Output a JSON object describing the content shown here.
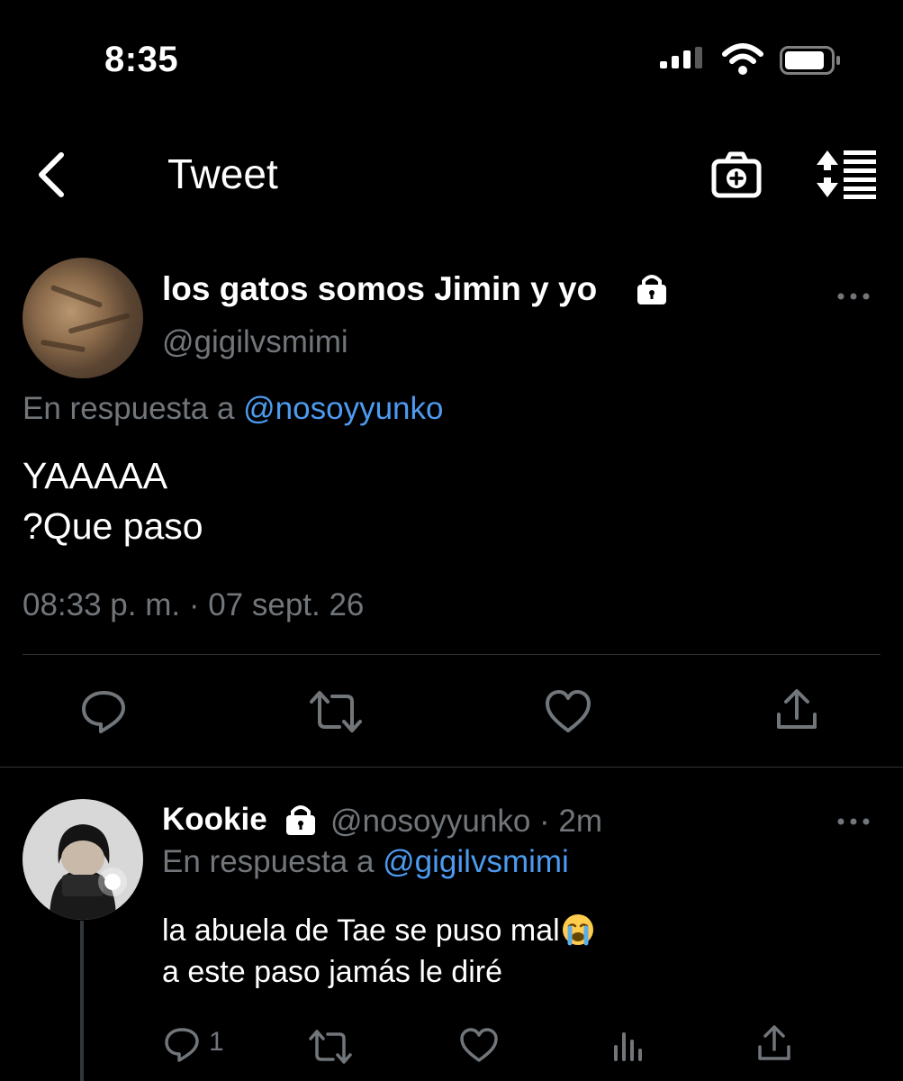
{
  "status_bar": {
    "time": "8:35"
  },
  "nav": {
    "title": "Tweet"
  },
  "main_tweet": {
    "display_name": "los gatos somos Jimin y yo",
    "handle": "@gigilvsmimi",
    "reply_prefix": "En respuesta a ",
    "reply_to": "@nosoyyunko",
    "text_line1": "YAAAAA",
    "text_line2": "?Que paso",
    "timestamp": "08:33 p. m. · 07 sept. 26"
  },
  "reply_tweet": {
    "display_name": "Kookie",
    "handle_time": "@nosoyyunko · 2m",
    "reply_prefix": "En respuesta a ",
    "reply_to": "@gigilvsmimi",
    "text_line1": "la abuela de Tae se puso mal",
    "text_line2": "a este paso jamás le diré",
    "reply_count": "1"
  },
  "icons": {
    "back": "chevron-left-icon",
    "camera": "camera-plus-icon",
    "sort": "sort-icon",
    "lock": "lock-icon",
    "more": "more-horizontal-icon",
    "reply": "reply-icon",
    "retweet": "retweet-icon",
    "like": "heart-icon",
    "share": "share-icon",
    "views": "views-icon",
    "emoji": "crying-face-emoji"
  },
  "colors": {
    "background": "#000000",
    "muted": "#71767b",
    "link": "#4d9bf0",
    "divider": "#2f3336"
  }
}
